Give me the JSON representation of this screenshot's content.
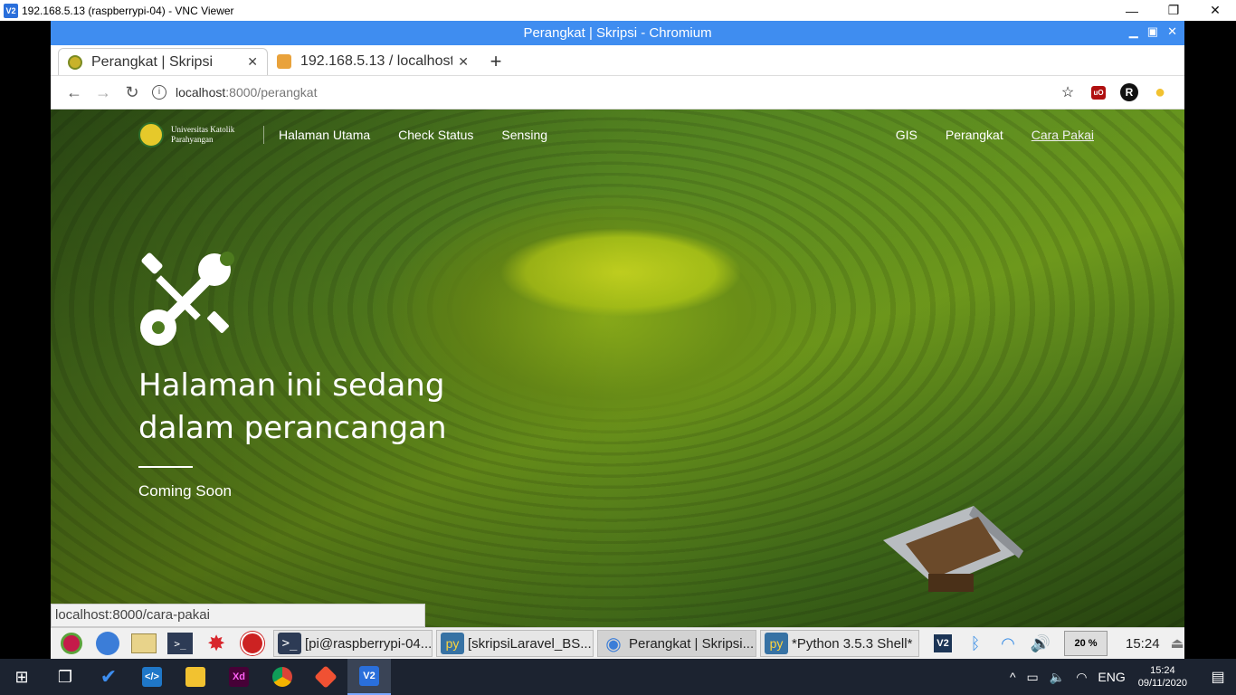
{
  "vnc": {
    "title": "192.168.5.13 (raspberrypi-04) - VNC Viewer",
    "logo": "V2",
    "minimize": "—",
    "restore": "❐",
    "close": "✕"
  },
  "chromium": {
    "window_title": "Perangkat | Skripsi - Chromium",
    "tabs": [
      {
        "label": "Perangkat | Skripsi",
        "close": "✕",
        "favicon_color": "#c9b22a"
      },
      {
        "label": "192.168.5.13 / localhost",
        "close": "✕",
        "favicon_color": "#e9a23b"
      }
    ],
    "new_tab": "+",
    "url_host": "localhost",
    "url_path": ":8000/perangkat",
    "back": "←",
    "forward": "→",
    "reload": "↻",
    "info_icon": "i",
    "star": "☆",
    "ext_ublock": "uO",
    "ext_r": "R",
    "ext_yellow": "●"
  },
  "site": {
    "university_name": "Universitas Katolik Parahyangan",
    "nav_left": [
      "Halaman Utama",
      "Check Status",
      "Sensing"
    ],
    "nav_right": [
      "GIS",
      "Perangkat",
      "Cara Pakai"
    ],
    "heading": "Halaman ini sedang dalam perancangan",
    "subtitle": "Coming Soon"
  },
  "status_url": "localhost:8000/cara-pakai",
  "rpi_taskbar": {
    "tasks": [
      {
        "label": "[pi@raspberrypi-04...",
        "icon": ">_"
      },
      {
        "label": "[skripsiLaravel_BS...",
        "icon": "py"
      },
      {
        "label": "Perangkat | Skripsi...",
        "icon": "◉"
      },
      {
        "label": "*Python 3.5.3 Shell*",
        "icon": "py"
      }
    ],
    "cpu": "20 %",
    "clock": "15:24"
  },
  "windows_taskbar": {
    "lang": "ENG",
    "time": "15:24",
    "date": "09/11/2020"
  },
  "colors": {
    "chromium_titlebar": "#3f8df0",
    "win_taskbar": "#1c2330"
  }
}
